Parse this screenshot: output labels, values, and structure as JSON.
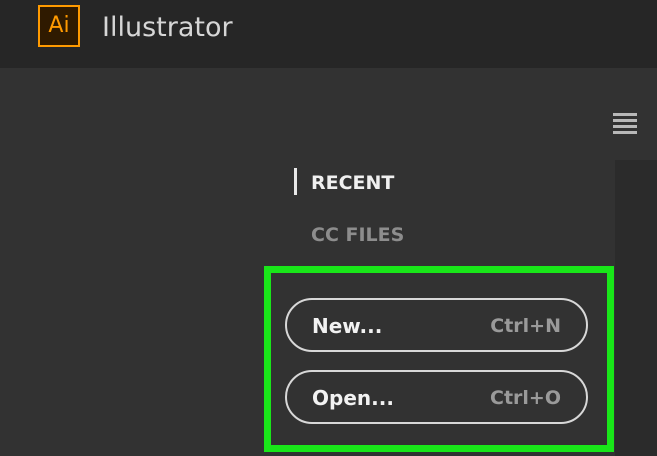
{
  "header": {
    "logo_text": "Ai",
    "app_name": "Illustrator"
  },
  "nav": {
    "recent": "RECENT",
    "cc_files": "CC FILES"
  },
  "actions": {
    "new_label": "New...",
    "new_shortcut": "Ctrl+N",
    "open_label": "Open...",
    "open_shortcut": "Ctrl+O"
  },
  "icons": {
    "menu": "hamburger-menu-icon",
    "logo": "illustrator-logo-icon"
  },
  "colors": {
    "accent": "#ff9a00",
    "highlight": "#19e619",
    "background": "#323232"
  }
}
